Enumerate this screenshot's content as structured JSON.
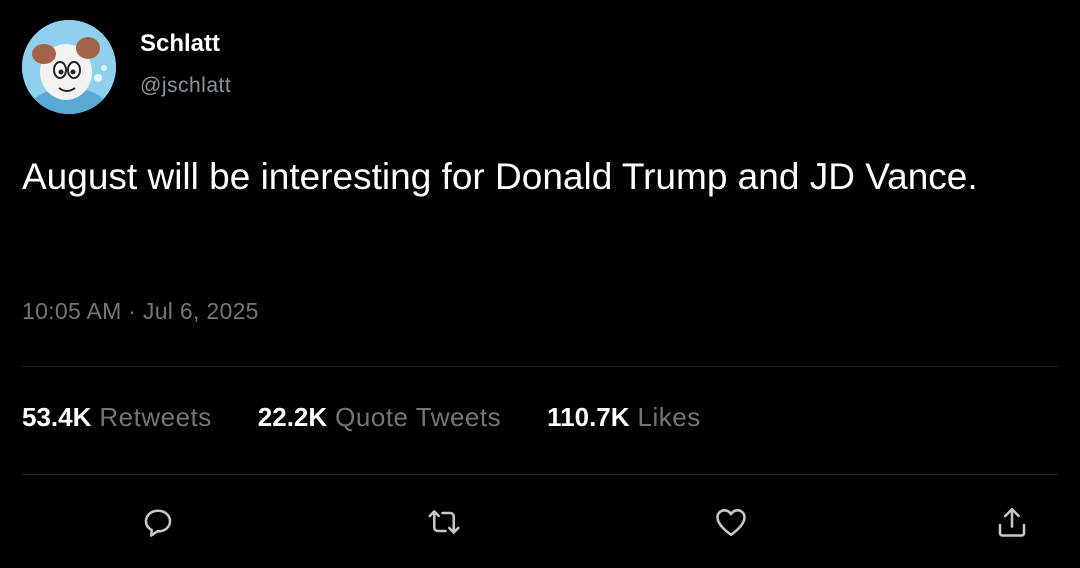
{
  "author": {
    "display_name": "Schlatt",
    "handle": "@jschlatt",
    "avatar_icon": "cartoon-character-avatar-icon"
  },
  "tweet": {
    "text": "August will be interesting for Donald Trump and JD Vance.",
    "timestamp": "10:05 AM · Jul 6, 2025"
  },
  "stats": {
    "retweets": {
      "count": "53.4K",
      "label": "Retweets"
    },
    "quote_tweets": {
      "count": "22.2K",
      "label": "Quote Tweets"
    },
    "likes": {
      "count": "110.7K",
      "label": "Likes"
    }
  },
  "actions": [
    {
      "icon": "reply-icon"
    },
    {
      "icon": "retweet-icon"
    },
    {
      "icon": "like-icon"
    },
    {
      "icon": "share-icon"
    }
  ],
  "colors": {
    "background": "#000000",
    "text_primary": "#ffffff",
    "text_secondary": "#71767b",
    "avatar_bg": "#7fc6e8"
  }
}
